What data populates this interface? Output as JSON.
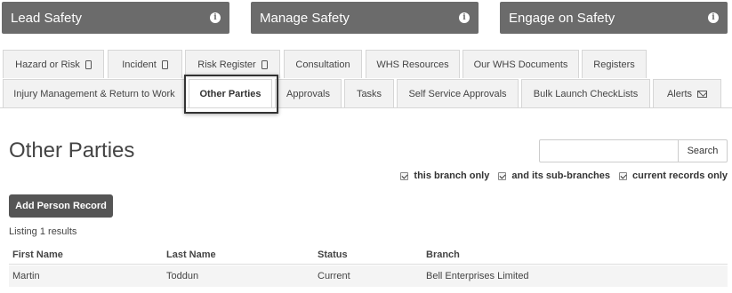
{
  "hero_buttons": [
    {
      "label": "Lead Safety"
    },
    {
      "label": "Manage Safety"
    },
    {
      "label": "Engage on Safety"
    }
  ],
  "tabs_row1": [
    {
      "label": "Hazard or Risk",
      "icon": "mobile-icon"
    },
    {
      "label": "Incident",
      "icon": "mobile-icon"
    },
    {
      "label": "Risk Register",
      "icon": "mobile-icon"
    },
    {
      "label": "Consultation"
    },
    {
      "label": "WHS Resources"
    },
    {
      "label": "Our WHS Documents"
    },
    {
      "label": "Registers"
    }
  ],
  "tabs_row2": [
    {
      "label": "Injury Management & Return to Work"
    },
    {
      "label": "Other Parties",
      "active": true
    },
    {
      "label": "Approvals"
    },
    {
      "label": "Tasks"
    },
    {
      "label": "Self Service Approvals"
    },
    {
      "label": "Bulk Launch CheckLists"
    },
    {
      "label": "Alerts",
      "icon": "envelope-icon"
    }
  ],
  "page": {
    "title": "Other Parties",
    "search_button": "Search",
    "filters": [
      "this branch only",
      "and its sub-branches",
      "current records only"
    ],
    "add_button": "Add Person Record",
    "listing": "Listing 1 results"
  },
  "table": {
    "headers": [
      "First Name",
      "Last Name",
      "Status",
      "Branch"
    ],
    "rows": [
      [
        "Martin",
        "Toddun",
        "Current",
        "Bell Enterprises Limited"
      ]
    ]
  },
  "colors": {
    "hero_bg": "#6b6b6b",
    "primary_button": "#555555"
  }
}
